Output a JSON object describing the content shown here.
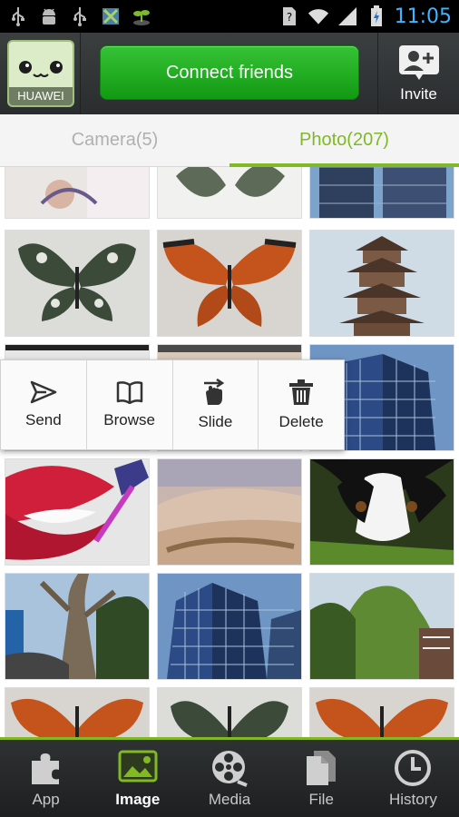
{
  "status_bar": {
    "time": "11:05",
    "left_icons": [
      "usb-icon",
      "android-debug-icon",
      "usb-icon",
      "app-notification-icon",
      "sprout-icon"
    ],
    "right_icons": [
      "no-sim-icon",
      "wifi-icon",
      "signal-icon",
      "battery-charging-icon"
    ]
  },
  "header": {
    "avatar_label": "HUAWEI",
    "connect_label": "Connect friends",
    "invite_label": "Invite"
  },
  "tabs": [
    {
      "label": "Camera(5)",
      "active": false
    },
    {
      "label": "Photo(207)",
      "active": true
    }
  ],
  "popup_menu": {
    "items": [
      {
        "label": "Send",
        "icon": "send-icon"
      },
      {
        "label": "Browse",
        "icon": "book-icon"
      },
      {
        "label": "Slide",
        "icon": "hand-swipe-icon"
      },
      {
        "label": "Delete",
        "icon": "trash-icon"
      }
    ]
  },
  "bottom_nav": {
    "items": [
      {
        "label": "App",
        "icon": "puzzle-icon",
        "active": false
      },
      {
        "label": "Image",
        "icon": "image-icon",
        "active": true
      },
      {
        "label": "Media",
        "icon": "film-reel-icon",
        "active": false
      },
      {
        "label": "File",
        "icon": "file-icon",
        "active": false
      },
      {
        "label": "History",
        "icon": "clock-icon",
        "active": false
      }
    ]
  },
  "colors": {
    "accent": "#80b923",
    "connect_button": "#1fa61f",
    "time": "#3fb4ff"
  }
}
